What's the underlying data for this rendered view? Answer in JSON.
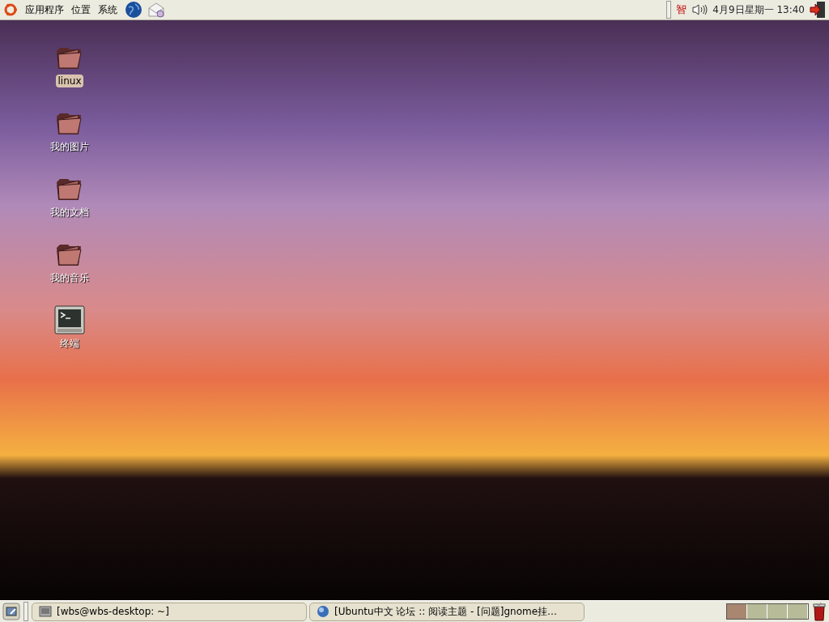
{
  "top_panel": {
    "menus": [
      "应用程序",
      "位置",
      "系统"
    ],
    "tray": {
      "input_method": "智",
      "clock": "4月9日星期一 13:40"
    }
  },
  "desktop_icons": [
    {
      "label": "linux",
      "kind": "folder",
      "selected": true
    },
    {
      "label": "我的图片",
      "kind": "folder",
      "selected": false
    },
    {
      "label": "我的文档",
      "kind": "folder",
      "selected": false
    },
    {
      "label": "我的音乐",
      "kind": "folder",
      "selected": false
    },
    {
      "label": "终端",
      "kind": "terminal",
      "selected": false
    }
  ],
  "taskbar": {
    "windows": [
      {
        "title": "[wbs@wbs-desktop: ~]",
        "kind": "terminal"
      },
      {
        "title": "[Ubuntu中文 论坛 :: 阅读主题 - [问题]gnome挂…",
        "kind": "browser"
      }
    ],
    "workspaces": [
      {
        "selected": true
      },
      {
        "selected": false
      },
      {
        "selected": false
      },
      {
        "selected": false
      }
    ]
  }
}
